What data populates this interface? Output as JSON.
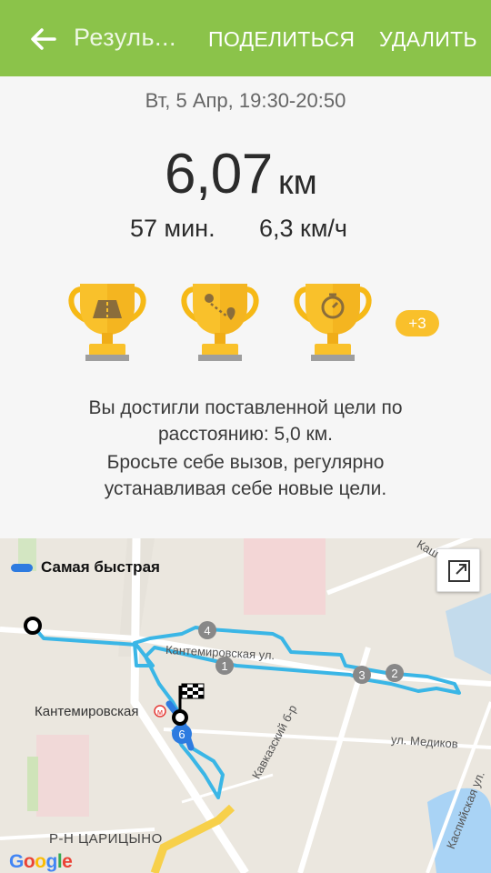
{
  "appbar": {
    "title": "Резуль...",
    "share_label": "ПОДЕЛИТЬСЯ",
    "delete_label": "УДАЛИТЬ",
    "color": "#8bc34a"
  },
  "summary": {
    "date_time": "Вт, 5 Апр, 19:30-20:50",
    "distance_value": "6,07",
    "distance_unit": "км",
    "duration": "57 мин.",
    "speed": "6,3 км/ч"
  },
  "achievements": {
    "trophies": [
      {
        "icon": "road-icon"
      },
      {
        "icon": "route-icon"
      },
      {
        "icon": "stopwatch-icon"
      }
    ],
    "more_badge": "+3",
    "trophy_color": "#f9c02b"
  },
  "messages": {
    "line1": "Вы достигли поставленной цели по",
    "line2": "расстоянию: 5,0 км.",
    "line3": "Бросьте себе вызов, регулярно",
    "line4": "устанавливая себе новые цели."
  },
  "map": {
    "legend_label": "Самая быстрая",
    "route_color": "#3ab6e6",
    "fast_color": "#2d7be0",
    "street_labels": {
      "kantemirovskaya_ul": "Кантемировская ул.",
      "kantemirovskaya_station": "Кантемировская",
      "medikov": "ул. Медиков",
      "kavkazsky": "Кавказский б-р",
      "kaspiyskaya": "Каспийская ул.",
      "kashirskoe": "Каш",
      "district": "Р-Н ЦАРИЦЫНО"
    },
    "km_markers": [
      "1",
      "2",
      "3",
      "4",
      "6"
    ],
    "attribution": "Google"
  }
}
